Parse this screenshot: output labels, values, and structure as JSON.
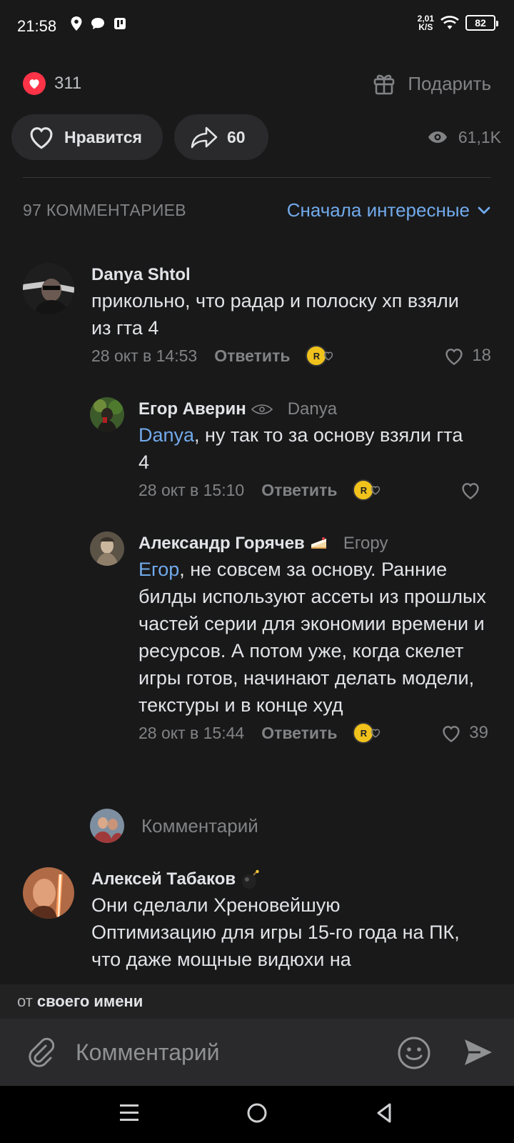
{
  "status_bar": {
    "time": "21:58",
    "net_speed_value": "2,01",
    "net_speed_unit": "K/S",
    "battery": "82"
  },
  "post": {
    "reaction_count": "311",
    "gift_label": "Подарить",
    "like_label": "Нравится",
    "share_count": "60",
    "views": "61,1K"
  },
  "comments_header": {
    "count_label": "97 КОММЕНТАРИЕВ",
    "sort_label": "Сначала интересные"
  },
  "comments": [
    {
      "author": "Danya Shtol",
      "text": "прикольно, что радар и полоску хп взяли из гта 4",
      "date": "28 окт в 14:53",
      "reply_label": "Ответить",
      "likes": "18"
    },
    {
      "author": "Егор Аверин",
      "reply_to": "Danya",
      "mention": "Danya",
      "text": ", ну так то за основу взяли гта 4",
      "date": "28 окт в 15:10",
      "reply_label": "Ответить",
      "likes": ""
    },
    {
      "author": "Александр Горячев",
      "reply_to": "Егору",
      "mention": "Егор",
      "text": ", не совсем за основу. Ранние билды используют ассеты из прошлых частей серии для экономии времени и ресурсов. А потом уже, когда скелет игры готов, начинают делать модели, текстуры и в конце худ",
      "date": "28 окт в 15:44",
      "reply_label": "Ответить",
      "likes": "39"
    },
    {
      "author": "Алексей Табаков",
      "text": "Они сделали Хреновейшую Оптимизацию для игры 15-го года на ПК, что даже мощные видюхи на"
    }
  ],
  "inline_reply_placeholder": "Комментарий",
  "composer": {
    "from_prefix": "от",
    "from_name": "своего имени",
    "placeholder": "Комментарий"
  },
  "colors": {
    "background": "#19191a",
    "accent_blue": "#71aaeb",
    "like_red": "#ff3347",
    "muted": "#828385"
  }
}
